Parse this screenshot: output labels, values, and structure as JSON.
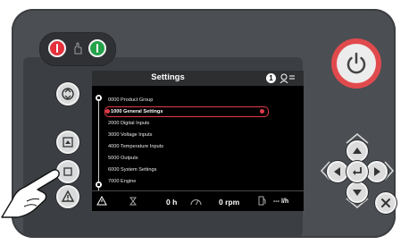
{
  "screen": {
    "title": "Settings",
    "info_glyph": "1",
    "menu": [
      {
        "label": "0000 Product Group",
        "selected": false
      },
      {
        "label": "1000 General Settings",
        "selected": true
      },
      {
        "label": "2000 Digital Inputs",
        "selected": false
      },
      {
        "label": "3000 Voltage Inputs",
        "selected": false
      },
      {
        "label": "4000 Temperature Inputs",
        "selected": false
      },
      {
        "label": "5000 Outputs",
        "selected": false
      },
      {
        "label": "6000 System Settings",
        "selected": false
      },
      {
        "label": "7000 Engine",
        "selected": false
      }
    ],
    "status": {
      "hours": "0 h",
      "rpm": "0 rpm",
      "flow": "--- l/h"
    }
  },
  "icons": {
    "stop": "stop-icon",
    "start": "start-icon",
    "power": "power-icon",
    "home": "home-icon",
    "warning": "warning-icon"
  },
  "colors": {
    "accent_red": "#e14a4d",
    "stop_red": "#e4313b",
    "start_green": "#23a24a",
    "selection": "#e23b4a"
  }
}
